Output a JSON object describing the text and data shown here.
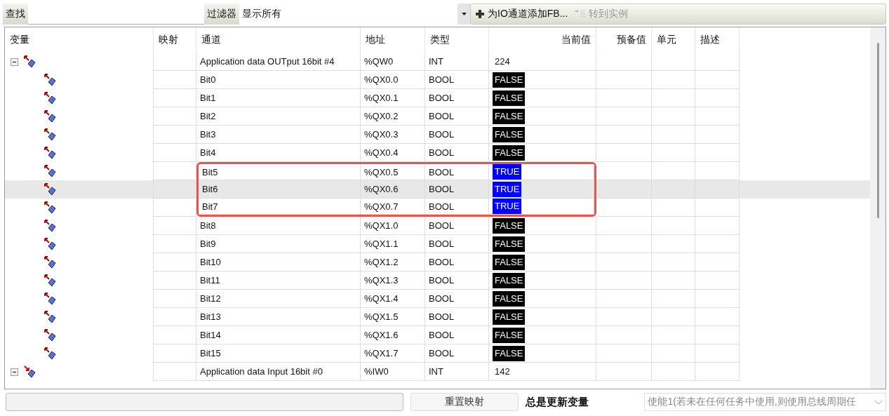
{
  "toolbar": {
    "find_label": "查找",
    "filter_label": "过滤器",
    "filter": {
      "value": "显示所有"
    },
    "add_fb": {
      "label": "为IO通道添加FB...",
      "disabled": false
    },
    "goto_instance": {
      "label": "转到实例",
      "disabled": true
    }
  },
  "table": {
    "columns": [
      "变量",
      "映射",
      "通道",
      "地址",
      "类型",
      "当前值",
      "预备值",
      "单元",
      "描述"
    ],
    "groups": [
      {
        "kind": "output",
        "expanded": true,
        "channel": "Application data OUTput 16bit #4",
        "address": "%QW0",
        "type": "INT",
        "value": {
          "kind": "number",
          "text": "224"
        },
        "children": [
          {
            "channel": "Bit0",
            "address": "%QX0.0",
            "type": "BOOL",
            "value": {
              "kind": "bool",
              "on": false,
              "text": "FALSE"
            },
            "selected": false,
            "boxed": false
          },
          {
            "channel": "Bit1",
            "address": "%QX0.1",
            "type": "BOOL",
            "value": {
              "kind": "bool",
              "on": false,
              "text": "FALSE"
            },
            "selected": false,
            "boxed": false
          },
          {
            "channel": "Bit2",
            "address": "%QX0.2",
            "type": "BOOL",
            "value": {
              "kind": "bool",
              "on": false,
              "text": "FALSE"
            },
            "selected": false,
            "boxed": false
          },
          {
            "channel": "Bit3",
            "address": "%QX0.3",
            "type": "BOOL",
            "value": {
              "kind": "bool",
              "on": false,
              "text": "FALSE"
            },
            "selected": false,
            "boxed": false
          },
          {
            "channel": "Bit4",
            "address": "%QX0.4",
            "type": "BOOL",
            "value": {
              "kind": "bool",
              "on": false,
              "text": "FALSE"
            },
            "selected": false,
            "boxed": false
          },
          {
            "channel": "Bit5",
            "address": "%QX0.5",
            "type": "BOOL",
            "value": {
              "kind": "bool",
              "on": true,
              "text": "TRUE"
            },
            "selected": false,
            "boxed": true
          },
          {
            "channel": "Bit6",
            "address": "%QX0.6",
            "type": "BOOL",
            "value": {
              "kind": "bool",
              "on": true,
              "text": "TRUE"
            },
            "selected": true,
            "boxed": true
          },
          {
            "channel": "Bit7",
            "address": "%QX0.7",
            "type": "BOOL",
            "value": {
              "kind": "bool",
              "on": true,
              "text": "TRUE"
            },
            "selected": false,
            "boxed": true
          },
          {
            "channel": "Bit8",
            "address": "%QX1.0",
            "type": "BOOL",
            "value": {
              "kind": "bool",
              "on": false,
              "text": "FALSE"
            },
            "selected": false,
            "boxed": false
          },
          {
            "channel": "Bit9",
            "address": "%QX1.1",
            "type": "BOOL",
            "value": {
              "kind": "bool",
              "on": false,
              "text": "FALSE"
            },
            "selected": false,
            "boxed": false
          },
          {
            "channel": "Bit10",
            "address": "%QX1.2",
            "type": "BOOL",
            "value": {
              "kind": "bool",
              "on": false,
              "text": "FALSE"
            },
            "selected": false,
            "boxed": false
          },
          {
            "channel": "Bit11",
            "address": "%QX1.3",
            "type": "BOOL",
            "value": {
              "kind": "bool",
              "on": false,
              "text": "FALSE"
            },
            "selected": false,
            "boxed": false
          },
          {
            "channel": "Bit12",
            "address": "%QX1.4",
            "type": "BOOL",
            "value": {
              "kind": "bool",
              "on": false,
              "text": "FALSE"
            },
            "selected": false,
            "boxed": false
          },
          {
            "channel": "Bit13",
            "address": "%QX1.5",
            "type": "BOOL",
            "value": {
              "kind": "bool",
              "on": false,
              "text": "FALSE"
            },
            "selected": false,
            "boxed": false
          },
          {
            "channel": "Bit14",
            "address": "%QX1.6",
            "type": "BOOL",
            "value": {
              "kind": "bool",
              "on": false,
              "text": "FALSE"
            },
            "selected": false,
            "boxed": false
          },
          {
            "channel": "Bit15",
            "address": "%QX1.7",
            "type": "BOOL",
            "value": {
              "kind": "bool",
              "on": false,
              "text": "FALSE"
            },
            "selected": false,
            "boxed": false
          }
        ]
      },
      {
        "kind": "input",
        "expanded": true,
        "channel": "Application data Input 16bit #0",
        "address": "%IW0",
        "type": "INT",
        "value": {
          "kind": "number",
          "text": "142"
        }
      }
    ]
  },
  "bottom": {
    "reset_button": "重置映射",
    "always_update_label": "总是更新变量",
    "update_mode": {
      "value": "使能1(若未在任何任务中使用,则使用总线周期任",
      "disabled": true
    }
  }
}
